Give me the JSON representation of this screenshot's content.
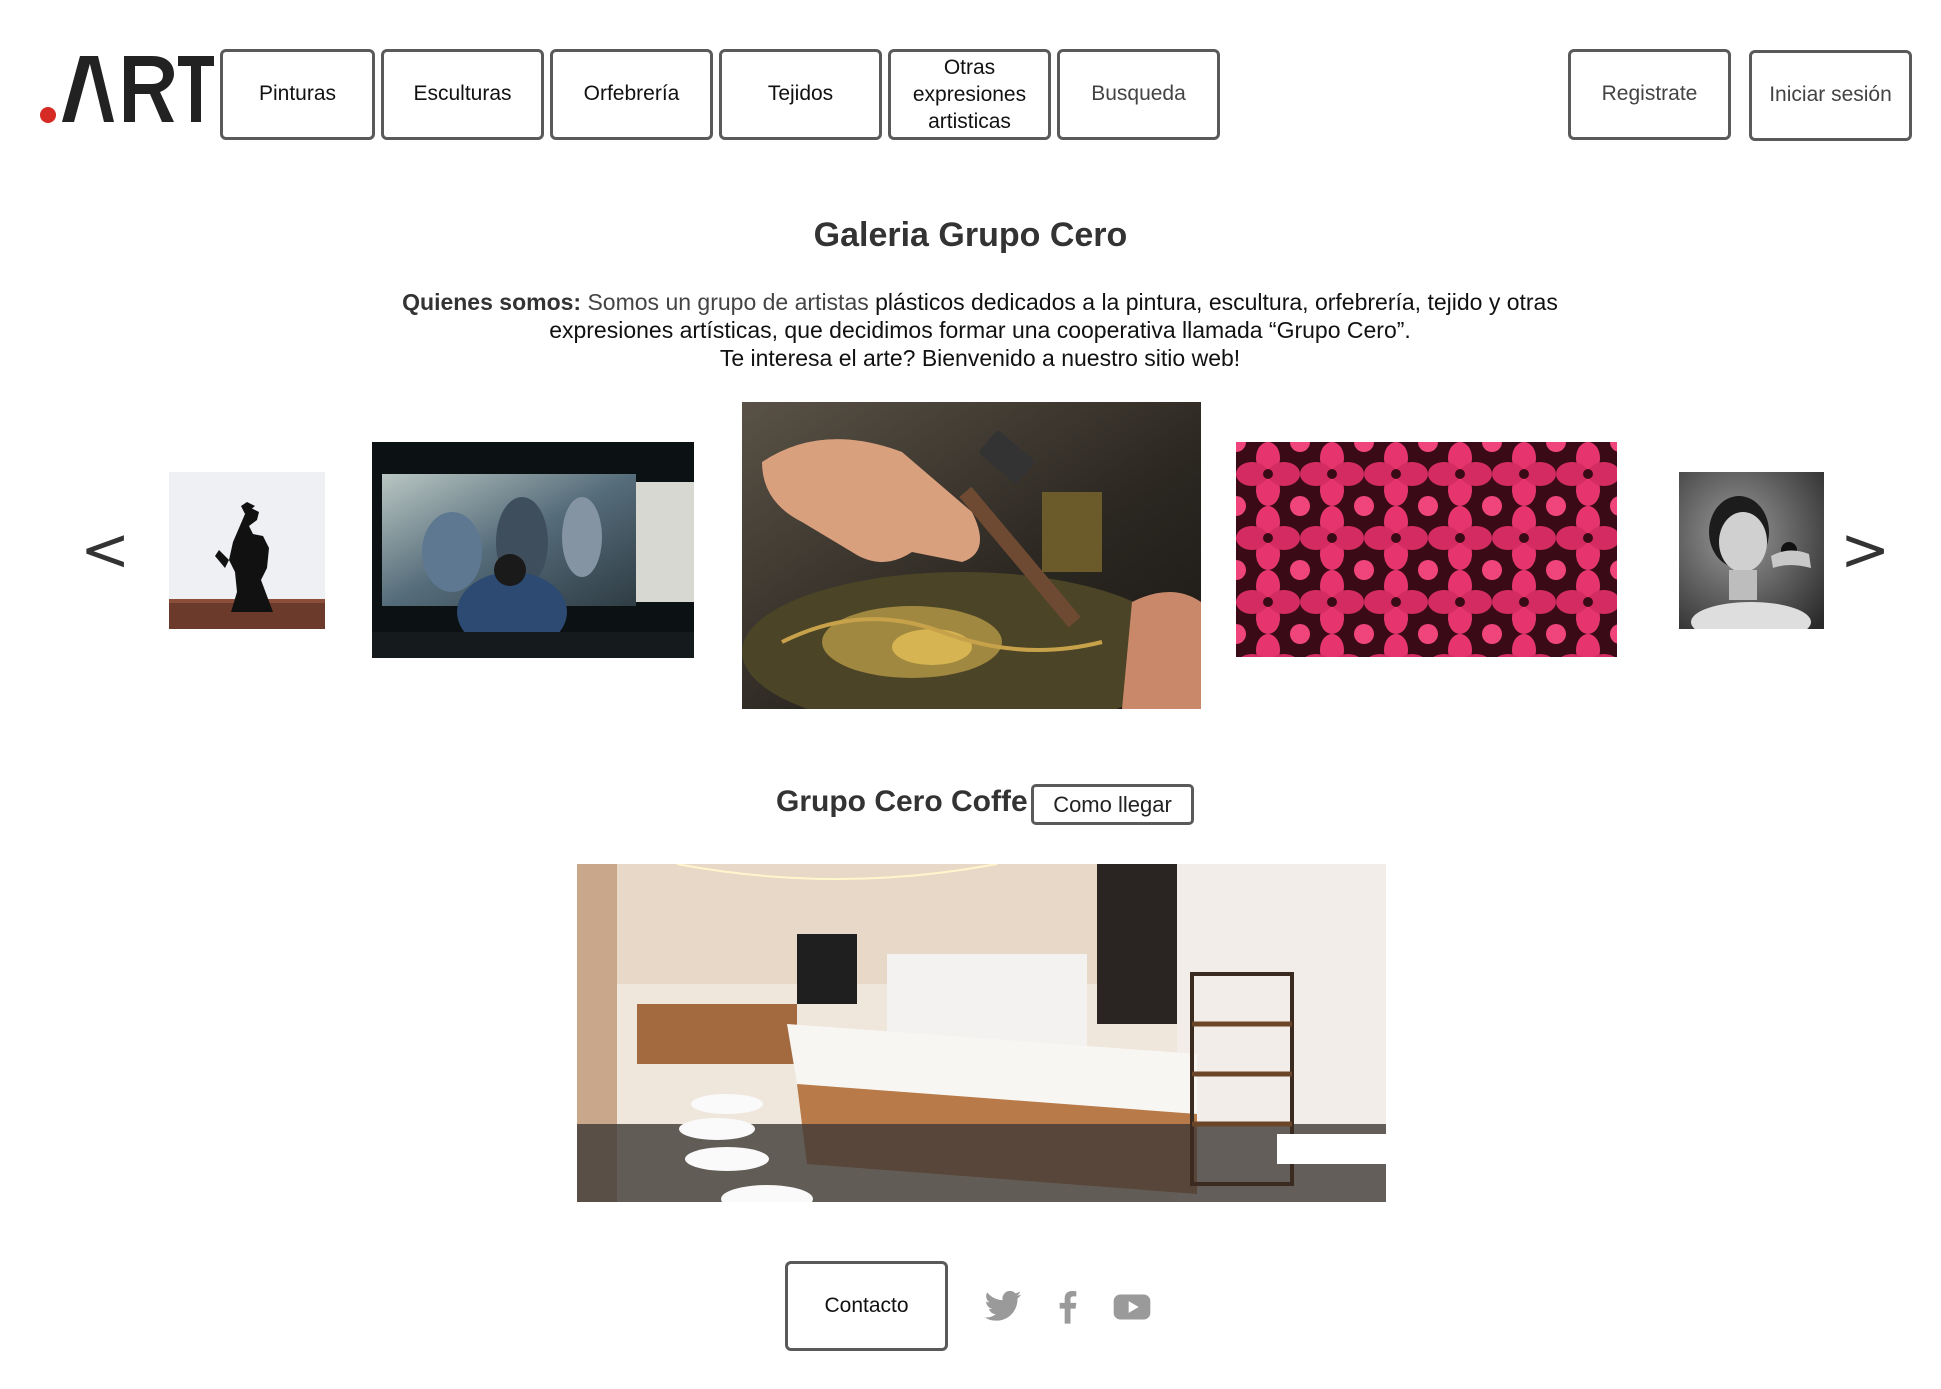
{
  "header": {
    "logo_text": ".ART",
    "nav": [
      {
        "label": "Pinturas"
      },
      {
        "label": "Esculturas"
      },
      {
        "label": "Orfebrería"
      },
      {
        "label": "Tejidos"
      },
      {
        "label": "Otras expresiones artisticas"
      },
      {
        "label": "Busqueda"
      }
    ],
    "register_label": "Registrate",
    "login_label": "Iniciar sesión"
  },
  "gallery": {
    "title": "Galeria Grupo Cero",
    "intro_label": "Quienes somos:",
    "intro_part1": " Somos un grupo de artistas",
    "intro_part2": " plásticos dedicados a la pintura, escultura, orfebrería, tejido y otras expresiones artísticas, que decidimos formar una cooperativa llamada “Grupo Cero”.",
    "intro_line2": "Te interesa el arte? Bienvenido a nuestro sitio web!"
  },
  "carousel": {
    "prev_label": "<",
    "next_label": ">",
    "images": [
      {
        "subject": "horse-sculpture"
      },
      {
        "subject": "painting-scene"
      },
      {
        "subject": "goldsmith-hammer"
      },
      {
        "subject": "pink-crochet"
      },
      {
        "subject": "bw-portrait"
      }
    ]
  },
  "coffee": {
    "title": "Grupo Cero Coffe",
    "directions_label": "Como llegar"
  },
  "footer": {
    "contact_label": "Contacto",
    "social": [
      "twitter-icon",
      "facebook-icon",
      "youtube-icon"
    ]
  },
  "colors": {
    "logo_dot": "#d62b25",
    "border": "#5a5a5a",
    "social_icon": "#9a9a9a"
  }
}
